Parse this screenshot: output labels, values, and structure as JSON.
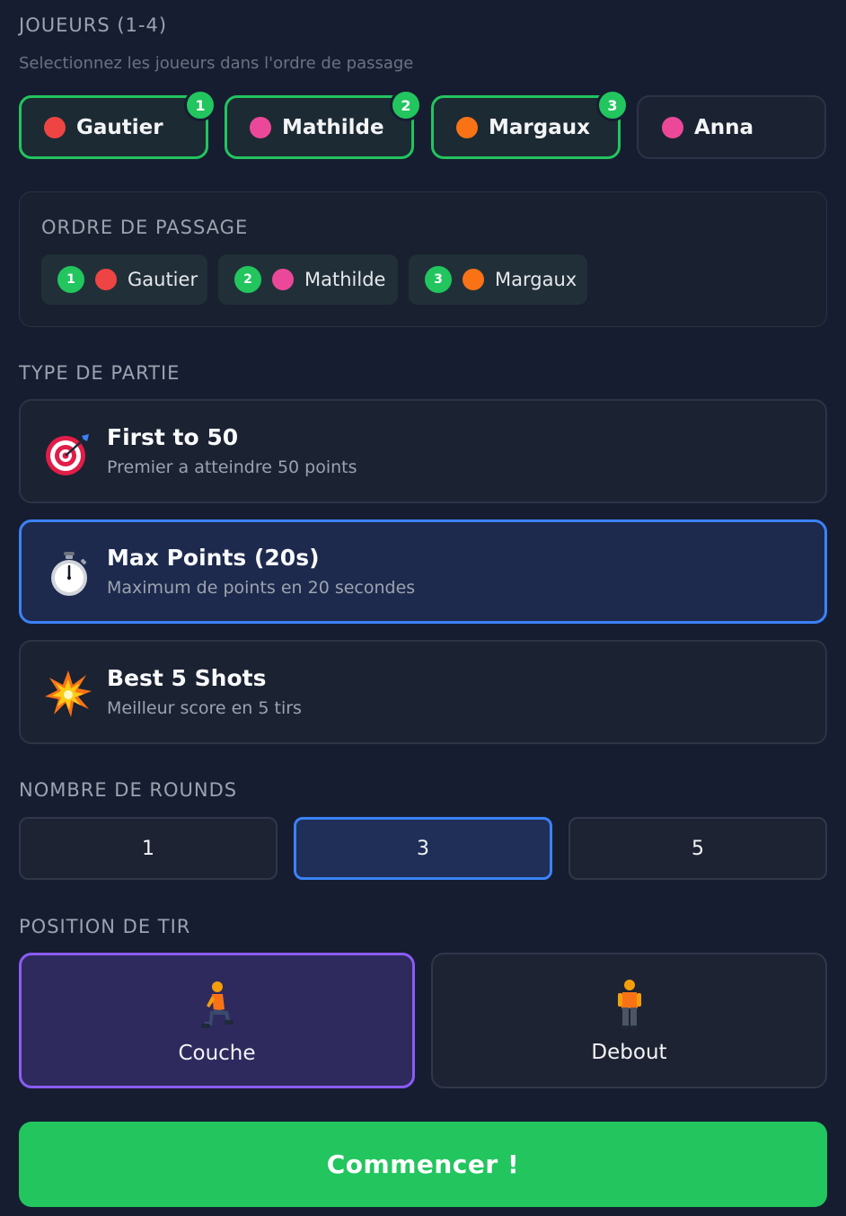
{
  "players_section": {
    "title": "JOUEURS (1-4)",
    "subtitle": "Selectionnez les joueurs dans l'ordre de passage",
    "players": [
      {
        "name": "Gautier",
        "color": "#ef4444",
        "order": "1",
        "selected": true
      },
      {
        "name": "Mathilde",
        "color": "#ec4899",
        "order": "2",
        "selected": true
      },
      {
        "name": "Margaux",
        "color": "#f97316",
        "order": "3",
        "selected": true
      },
      {
        "name": "Anna",
        "color": "#ec4899",
        "order": "",
        "selected": false
      }
    ]
  },
  "order_section": {
    "title": "ORDRE DE PASSAGE",
    "items": [
      {
        "num": "1",
        "name": "Gautier",
        "color": "#ef4444"
      },
      {
        "num": "2",
        "name": "Mathilde",
        "color": "#ec4899"
      },
      {
        "num": "3",
        "name": "Margaux",
        "color": "#f97316"
      }
    ]
  },
  "game_type": {
    "title": "TYPE DE PARTIE",
    "modes": [
      {
        "icon": "target-icon",
        "title": "First to 50",
        "desc": "Premier a atteindre 50 points",
        "selected": false
      },
      {
        "icon": "stopwatch-icon",
        "title": "Max Points (20s)",
        "desc": "Maximum de points en 20 secondes",
        "selected": true
      },
      {
        "icon": "explosion-icon",
        "title": "Best 5 Shots",
        "desc": "Meilleur score en 5 tirs",
        "selected": false
      }
    ]
  },
  "rounds": {
    "title": "NOMBRE DE ROUNDS",
    "options": [
      "1",
      "3",
      "5"
    ],
    "selected": "3"
  },
  "position": {
    "title": "POSITION DE TIR",
    "options": [
      {
        "icon": "kneeling-person-icon",
        "label": "Couche",
        "selected": true
      },
      {
        "icon": "standing-person-icon",
        "label": "Debout",
        "selected": false
      }
    ]
  },
  "start_button": {
    "label": "Commencer !"
  },
  "colors": {
    "accent_green": "#22c55e",
    "accent_blue": "#3b82f6",
    "accent_purple": "#8b5cf6",
    "background": "#161d31"
  }
}
